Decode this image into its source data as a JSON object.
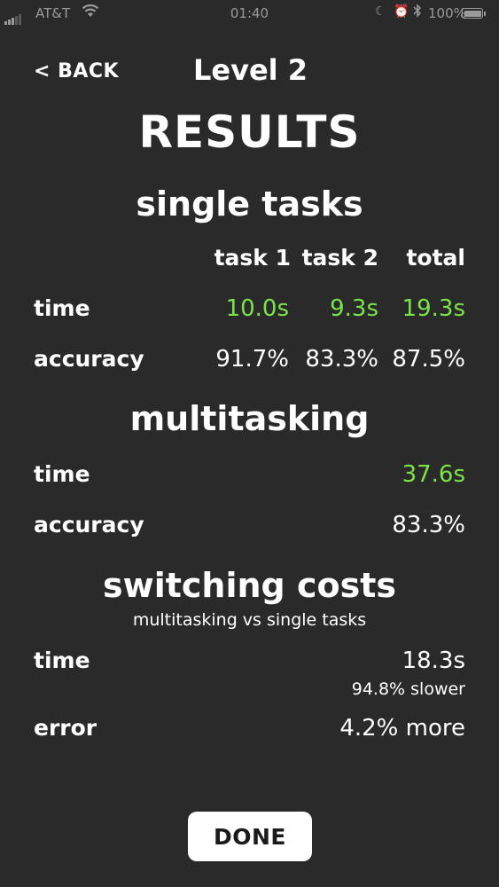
{
  "status_bar": {
    "carrier": "AT&T",
    "time": "01:40",
    "battery": "100%"
  },
  "header": {
    "back_label": "< BACK",
    "level_title": "Level 2",
    "page_title": "RESULTS"
  },
  "single_tasks": {
    "title": "single tasks",
    "columns": [
      "task 1",
      "task 2",
      "total"
    ],
    "time_label": "time",
    "time_values": [
      "10.0s",
      "9.3s",
      "19.3s"
    ],
    "accuracy_label": "accuracy",
    "accuracy_values": [
      "91.7%",
      "83.3%",
      "87.5%"
    ]
  },
  "multitasking": {
    "title": "multitasking",
    "time_label": "time",
    "time_value": "37.6s",
    "accuracy_label": "accuracy",
    "accuracy_value": "83.3%"
  },
  "switching_costs": {
    "title": "switching costs",
    "subtitle": "multitasking vs single tasks",
    "time_label": "time",
    "time_value": "18.3s",
    "time_note": "94.8% slower",
    "error_label": "error",
    "error_value": "4.2% more"
  },
  "done_label": "DONE",
  "colors": {
    "background": "#2a2a2a",
    "time_highlight": "#7be34a",
    "text": "#ffffff"
  }
}
